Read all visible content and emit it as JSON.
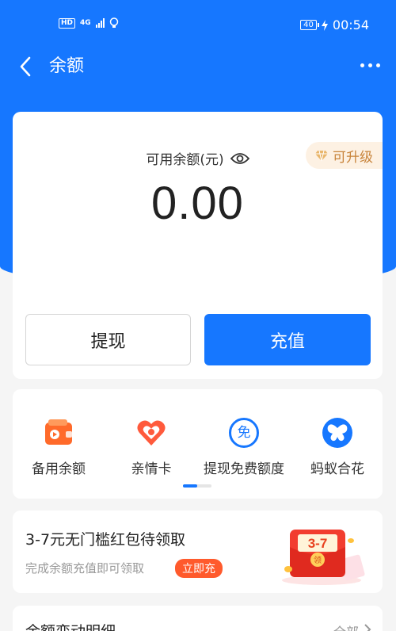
{
  "status_bar": {
    "network": "4G",
    "hd": "HD",
    "battery": "40",
    "time": "00:54"
  },
  "nav": {
    "title": "余额"
  },
  "balance": {
    "label": "可用余额(元)",
    "amount": "0.00",
    "upgrade_label": "可升级",
    "withdraw_label": "提现",
    "recharge_label": "充值"
  },
  "features": {
    "items": [
      {
        "label": "备用余额",
        "icon": "wallet-icon"
      },
      {
        "label": "亲情卡",
        "icon": "heart-icon"
      },
      {
        "label": "提现免费额度",
        "icon": "free-icon"
      },
      {
        "label": "蚂蚁合花",
        "icon": "butterfly-icon"
      }
    ],
    "free_glyph": "免"
  },
  "promo": {
    "title": "3-7元无门槛红包待领取",
    "subtitle": "完成余额充值即可领取",
    "button_label": "立即充",
    "envelope_text": "3-7",
    "envelope_coin": "领"
  },
  "detail": {
    "title": "余额变动明细",
    "all_label": "全部"
  },
  "colors": {
    "brand_blue": "#1677ff",
    "promo_orange": "#ff5a2c",
    "gold": "#c8843b"
  }
}
